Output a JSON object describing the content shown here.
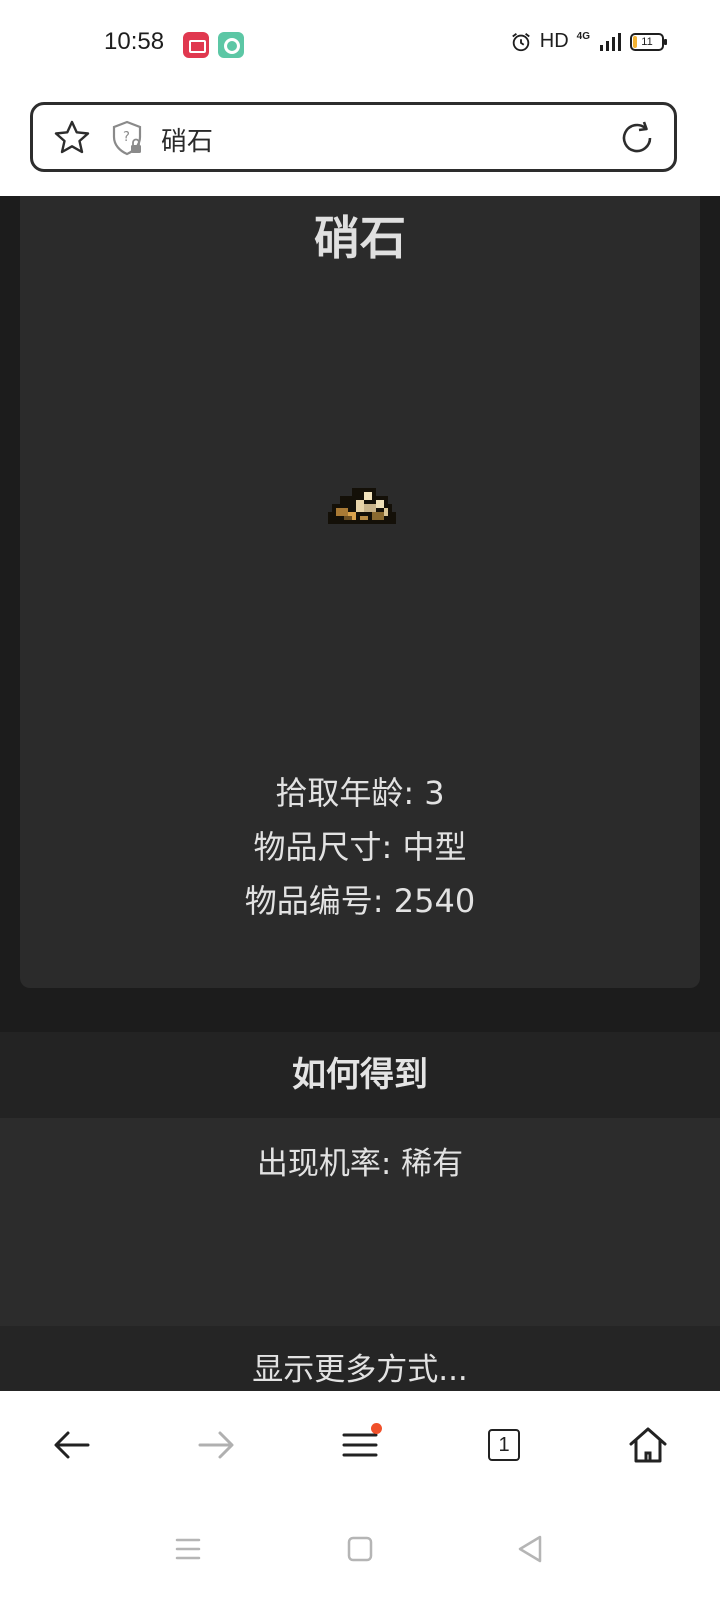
{
  "status_bar": {
    "time": "10:58",
    "network_label": "HD",
    "network_type": "4G",
    "battery_level": "11"
  },
  "address_bar": {
    "text": "硝石"
  },
  "item": {
    "title": "硝石",
    "stats": [
      {
        "label": "拾取年龄",
        "value": "3"
      },
      {
        "label": "物品尺寸",
        "value": "中型"
      },
      {
        "label": "物品编号",
        "value": "2540"
      }
    ],
    "stat_lines": [
      "拾取年龄: 3",
      "物品尺寸: 中型",
      "物品编号: 2540"
    ]
  },
  "obtain": {
    "header": "如何得到",
    "rarity_line": "出现机率: 稀有",
    "show_more": "显示更多方式..."
  },
  "toolbar": {
    "tab_count": "1",
    "menu_has_notification": true
  },
  "colors": {
    "page_background": "#1c1c1c",
    "card_background": "#2b2b2b",
    "notification_dot": "#f0502a",
    "battery_fill": "#f2b233"
  }
}
